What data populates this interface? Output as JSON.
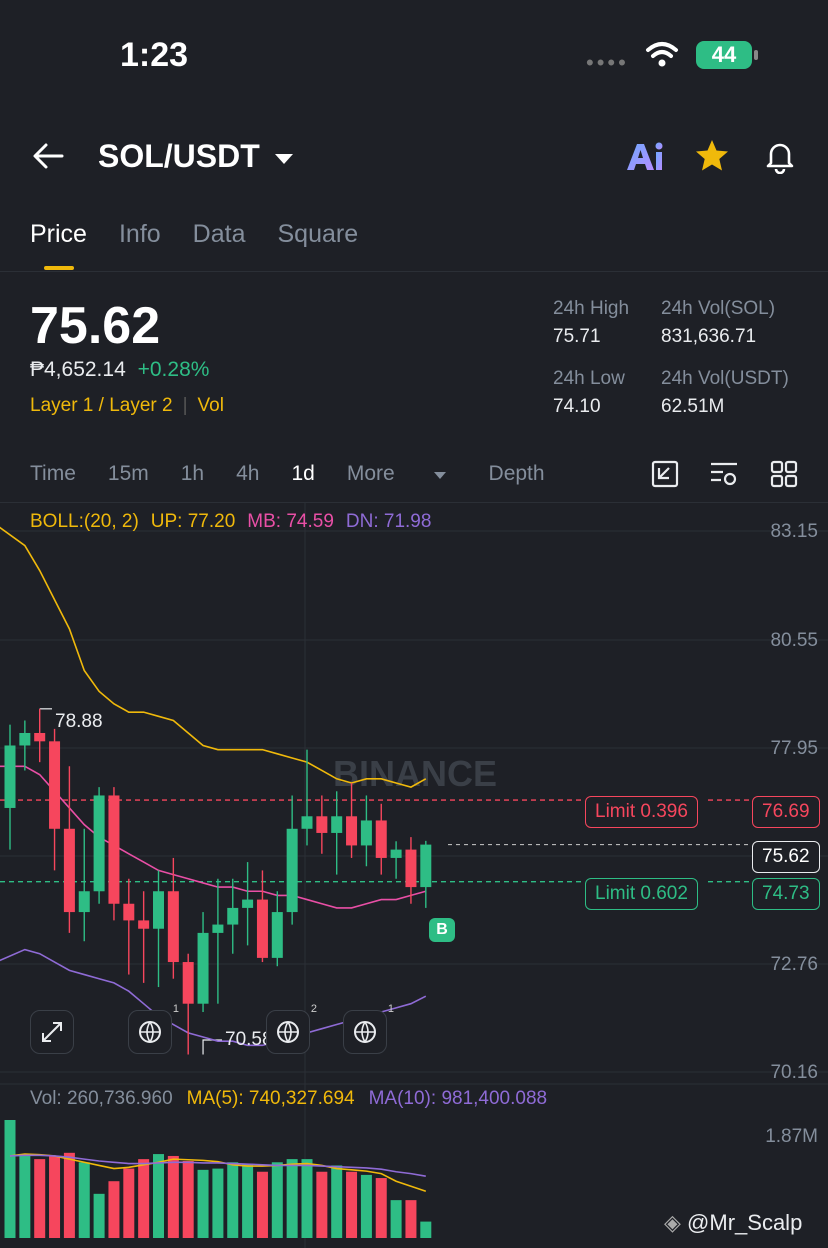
{
  "status": {
    "time": "1:23",
    "battery": "44"
  },
  "header": {
    "pair": "SOL/USDT"
  },
  "tabs": [
    "Price",
    "Info",
    "Data",
    "Square"
  ],
  "ticker": {
    "last": "75.62",
    "fiat": "₱4,652.14",
    "change": "+0.28%",
    "tag1": "Layer 1 / Layer 2",
    "tag2": "Vol",
    "high_label": "24h High",
    "high": "75.71",
    "low_label": "24h Low",
    "low": "74.10",
    "vol_sol_label": "24h Vol(SOL)",
    "vol_sol": "831,636.71",
    "vol_usdt_label": "24h Vol(USDT)",
    "vol_usdt": "62.51M"
  },
  "intervals": {
    "time": "Time",
    "m15": "15m",
    "h1": "1h",
    "h4": "4h",
    "d1": "1d",
    "more": "More",
    "depth": "Depth"
  },
  "boll": {
    "name": "BOLL:(20, 2)",
    "up": "UP: 77.20",
    "mb": "MB: 74.59",
    "dn": "DN: 71.98"
  },
  "price_axis": [
    "83.15",
    "80.55",
    "77.95",
    "72.76",
    "70.16"
  ],
  "limits": {
    "sell_label": "Limit 0.396",
    "sell_price": "76.69",
    "buy_label": "Limit 0.602",
    "buy_price": "74.73",
    "current": "75.62",
    "buy_marker": "B"
  },
  "annotations": {
    "high": "78.88",
    "low": "70.58"
  },
  "watermark": "BINANCE",
  "badges": [
    "1",
    "2",
    "1"
  ],
  "volume": {
    "vol": "Vol: 260,736.960",
    "ma5": "MA(5): 740,327.694",
    "ma10": "MA(10): 981,400.088",
    "axis_top": "1.87M"
  },
  "credit": "@Mr_Scalp",
  "colors": {
    "up": "#2ebd85",
    "down": "#f6465d",
    "accent": "#f0b90b",
    "mb": "#e94fa6",
    "dn": "#8f6bd6"
  },
  "chart_data": {
    "type": "candlestick",
    "candles": [
      {
        "o": 76.5,
        "h": 78.5,
        "l": 75.5,
        "c": 78.0
      },
      {
        "o": 78.0,
        "h": 78.6,
        "l": 77.4,
        "c": 78.3
      },
      {
        "o": 78.3,
        "h": 78.88,
        "l": 77.6,
        "c": 78.1
      },
      {
        "o": 78.1,
        "h": 78.4,
        "l": 75.0,
        "c": 76.0
      },
      {
        "o": 76.0,
        "h": 77.5,
        "l": 73.5,
        "c": 74.0
      },
      {
        "o": 74.0,
        "h": 76.0,
        "l": 73.3,
        "c": 74.5
      },
      {
        "o": 74.5,
        "h": 77.0,
        "l": 74.2,
        "c": 76.8
      },
      {
        "o": 76.8,
        "h": 77.0,
        "l": 73.8,
        "c": 74.2
      },
      {
        "o": 74.2,
        "h": 74.8,
        "l": 72.5,
        "c": 73.8
      },
      {
        "o": 73.8,
        "h": 74.5,
        "l": 72.3,
        "c": 73.6
      },
      {
        "o": 73.6,
        "h": 75.0,
        "l": 72.2,
        "c": 74.5
      },
      {
        "o": 74.5,
        "h": 75.3,
        "l": 72.4,
        "c": 72.8
      },
      {
        "o": 72.8,
        "h": 73.0,
        "l": 70.58,
        "c": 71.8
      },
      {
        "o": 71.8,
        "h": 74.0,
        "l": 71.6,
        "c": 73.5
      },
      {
        "o": 73.5,
        "h": 74.8,
        "l": 71.8,
        "c": 73.7
      },
      {
        "o": 73.7,
        "h": 74.8,
        "l": 73.0,
        "c": 74.1
      },
      {
        "o": 74.1,
        "h": 75.2,
        "l": 73.2,
        "c": 74.3
      },
      {
        "o": 74.3,
        "h": 75.0,
        "l": 72.8,
        "c": 72.9
      },
      {
        "o": 72.9,
        "h": 74.5,
        "l": 72.7,
        "c": 74.0
      },
      {
        "o": 74.0,
        "h": 76.8,
        "l": 73.7,
        "c": 76.0
      },
      {
        "o": 76.0,
        "h": 77.9,
        "l": 75.6,
        "c": 76.3
      },
      {
        "o": 76.3,
        "h": 76.8,
        "l": 75.4,
        "c": 75.9
      },
      {
        "o": 75.9,
        "h": 76.9,
        "l": 74.9,
        "c": 76.3
      },
      {
        "o": 76.3,
        "h": 77.1,
        "l": 75.3,
        "c": 75.6
      },
      {
        "o": 75.6,
        "h": 76.8,
        "l": 75.1,
        "c": 76.2
      },
      {
        "o": 76.2,
        "h": 76.6,
        "l": 74.9,
        "c": 75.3
      },
      {
        "o": 75.3,
        "h": 75.7,
        "l": 74.8,
        "c": 75.5
      },
      {
        "o": 75.5,
        "h": 75.8,
        "l": 74.2,
        "c": 74.6
      },
      {
        "o": 74.6,
        "h": 75.71,
        "l": 74.1,
        "c": 75.62
      }
    ],
    "upper": [
      83.3,
      82.8,
      82.2,
      81.5,
      80.8,
      79.8,
      79.3,
      79.0,
      78.8,
      78.8,
      78.7,
      78.6,
      78.3,
      78.0,
      77.9,
      77.9,
      77.9,
      77.9,
      77.8,
      77.7,
      77.6,
      77.4,
      77.2,
      77.1,
      77.2,
      77.2,
      77.1,
      77.0,
      77.2
    ],
    "middle": [
      77.5,
      77.5,
      77.3,
      76.9,
      76.5,
      76.1,
      75.8,
      75.6,
      75.4,
      75.2,
      75.0,
      74.9,
      74.8,
      74.7,
      74.6,
      74.6,
      74.5,
      74.5,
      74.4,
      74.4,
      74.3,
      74.2,
      74.1,
      74.1,
      74.2,
      74.3,
      74.3,
      74.4,
      74.5
    ],
    "lower": [
      72.8,
      73.1,
      73.0,
      72.8,
      72.6,
      72.5,
      72.4,
      72.3,
      72.1,
      71.8,
      71.5,
      71.3,
      71.1,
      71.0,
      70.9,
      70.9,
      70.8,
      70.8,
      70.9,
      71.0,
      71.1,
      71.2,
      71.3,
      71.4,
      71.5,
      71.6,
      71.7,
      71.8,
      71.98
    ],
    "volume": [
      1.87,
      1.3,
      1.25,
      1.3,
      1.35,
      1.2,
      0.7,
      0.9,
      1.1,
      1.25,
      1.33,
      1.3,
      1.22,
      1.08,
      1.1,
      1.2,
      1.18,
      1.05,
      1.2,
      1.25,
      1.25,
      1.05,
      1.15,
      1.05,
      1.0,
      0.95,
      0.6,
      0.6,
      0.26
    ],
    "ma5": [
      1.3,
      1.33,
      1.32,
      1.3,
      1.25,
      1.2,
      1.15,
      1.1,
      1.12,
      1.16,
      1.2,
      1.25,
      1.24,
      1.23,
      1.21,
      1.16,
      1.14,
      1.14,
      1.15,
      1.17,
      1.18,
      1.15,
      1.1,
      1.08,
      1.06,
      1.02,
      0.9,
      0.82,
      0.74
    ],
    "ma10": [
      1.3,
      1.31,
      1.31,
      1.3,
      1.28,
      1.25,
      1.22,
      1.2,
      1.18,
      1.18,
      1.19,
      1.2,
      1.2,
      1.19,
      1.19,
      1.18,
      1.17,
      1.16,
      1.15,
      1.15,
      1.15,
      1.14,
      1.13,
      1.12,
      1.11,
      1.09,
      1.05,
      1.02,
      0.98
    ],
    "ylim": [
      70.16,
      83.15
    ],
    "vol_max": 1.87
  }
}
